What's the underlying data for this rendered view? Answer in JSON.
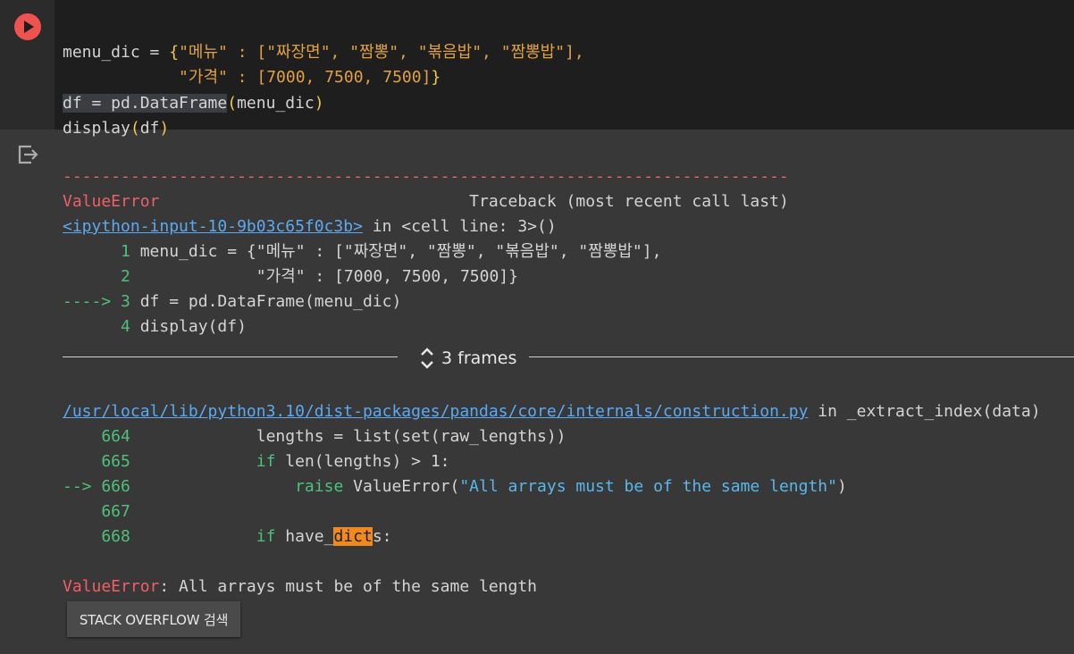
{
  "code_cell": {
    "lines": [
      {
        "a": "menu_dic = ",
        "b": "{",
        "c": "\"메뉴\" : [\"짜장면\", \"짬뽕\", \"볶음밥\", \"짬뽕밥\"],",
        "d": ""
      },
      {
        "a": "            ",
        "b": "",
        "c": "\"가격\" : [7000, 7500, 7500]",
        "d": "}"
      },
      {
        "a": "df = pd.DataFrame",
        "b": "(",
        "c": "menu_dic",
        "d": ")"
      },
      {
        "a": "display",
        "b": "(",
        "c": "df",
        "d": ")"
      }
    ]
  },
  "traceback": {
    "dashes": "---------------------------------------------------------------------------",
    "error_type": "ValueError",
    "header_right": "                                Traceback (most recent call last)",
    "input_link": "<ipython-input-10-9b03c65f0c3b>",
    "in_cell": " in <cell line: 3>()",
    "cell_lines": [
      {
        "marker": "      ",
        "num": "1",
        "text": " menu_dic = {\"메뉴\" : [\"짜장면\", \"짬뽕\", \"볶음밥\", \"짬뽕밥\"],"
      },
      {
        "marker": "      ",
        "num": "2",
        "text": "             \"가격\" : [7000, 7500, 7500]}"
      },
      {
        "marker": "----> ",
        "num": "3",
        "text": " df = pd.DataFrame(menu_dic)"
      },
      {
        "marker": "      ",
        "num": "4",
        "text": " display(df)"
      }
    ],
    "frames_label": "3 frames",
    "file_link": "/usr/local/lib/python3.10/dist-packages/pandas/core/internals/construction.py",
    "file_in": " in _extract_index(data)",
    "final_error_type": "ValueError",
    "final_message": ": All arrays must be of the same length"
  },
  "stack_overflow_button": "STACK OVERFLOW 검색"
}
